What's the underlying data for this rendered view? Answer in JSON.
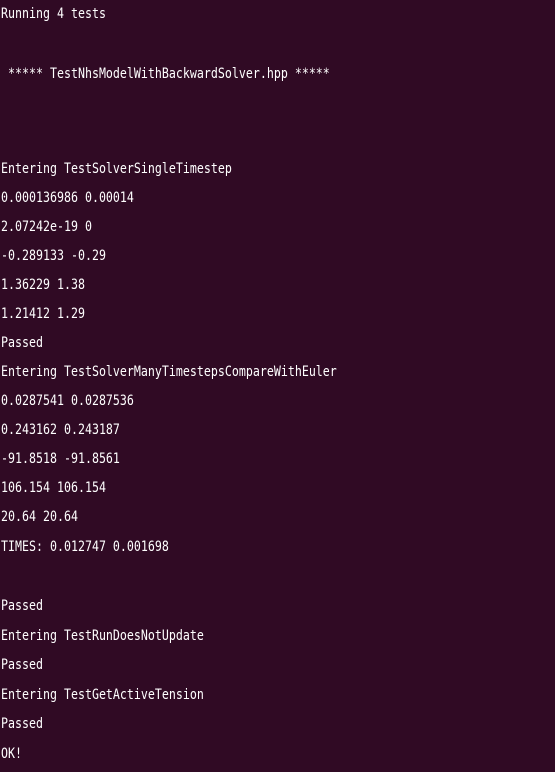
{
  "terminal": {
    "colors": {
      "background": "#300a24",
      "foreground": "#ffffff"
    },
    "lines": [
      "Running 4 tests",
      "",
      " ***** TestNhsModelWithBackwardSolver.hpp *****",
      "",
      "",
      "",
      "Entering TestSolverSingleTimestep",
      "0.000136986 0.00014",
      "2.07242e-19 0",
      "-0.289133 -0.29",
      "1.36229 1.38",
      "1.21412 1.29",
      "Passed",
      "Entering TestSolverManyTimestepsCompareWithEuler",
      "0.0287541 0.0287536",
      "0.243162 0.243187",
      "-91.8518 -91.8561",
      "106.154 106.154",
      "20.64 20.64",
      "TIMES: 0.012747 0.001698",
      "",
      "Passed",
      "Entering TestRunDoesNotUpdate",
      "Passed",
      "Entering TestGetActiveTension",
      "Passed",
      "OK!"
    ]
  }
}
